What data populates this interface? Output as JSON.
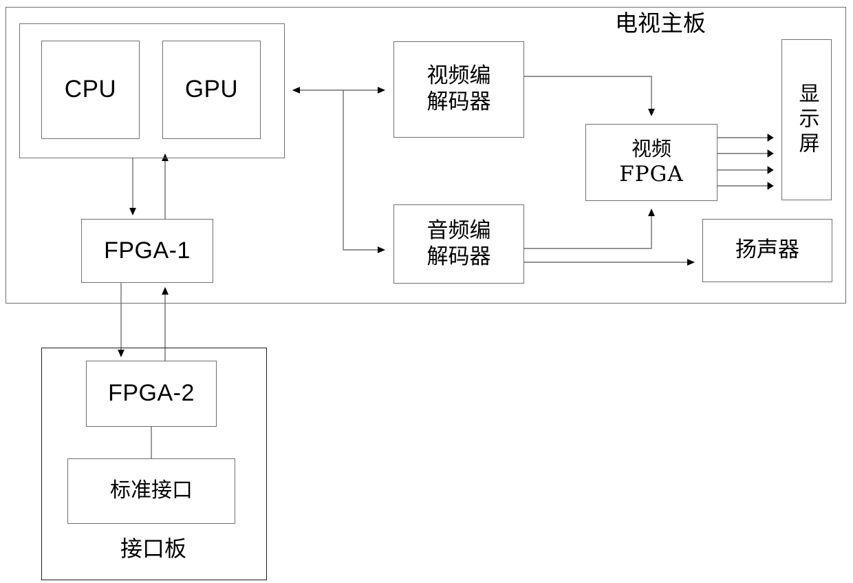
{
  "diagram": {
    "title": "电视主板",
    "title_en_hint": "TV motherboard block diagram",
    "background_color": "#ffffff",
    "line_color": "#6f6f6f",
    "text_color": "#000000"
  },
  "boards": {
    "motherboard": {
      "label": "电视主板"
    },
    "interface_board": {
      "label": "接口板"
    }
  },
  "blocks": {
    "soc": {
      "label": ""
    },
    "cpu": {
      "label": "CPU"
    },
    "gpu": {
      "label": "GPU"
    },
    "fpga1": {
      "label": "FPGA-1"
    },
    "fpga2": {
      "label": "FPGA-2"
    },
    "standard_interface": {
      "label": "标准接口"
    },
    "video_codec": {
      "line1": "视频编",
      "line2": "解码器"
    },
    "audio_codec": {
      "line1": "音频编",
      "line2": "解码器"
    },
    "video_fpga": {
      "line1": "视频",
      "line2": "FPGA"
    },
    "display": {
      "label": "显示屏"
    },
    "speaker": {
      "label": "扬声器"
    }
  },
  "connections": [
    {
      "from": "soc",
      "to": "video_codec",
      "type": "bidirectional-bus"
    },
    {
      "from": "soc",
      "to": "audio_codec",
      "type": "directed"
    },
    {
      "from": "soc",
      "to": "fpga1",
      "type": "down"
    },
    {
      "from": "fpga1",
      "to": "soc",
      "type": "up"
    },
    {
      "from": "fpga1",
      "to": "fpga2",
      "type": "down"
    },
    {
      "from": "fpga2",
      "to": "fpga1",
      "type": "up"
    },
    {
      "from": "fpga2",
      "to": "standard_interface",
      "type": "plain"
    },
    {
      "from": "video_codec",
      "to": "video_fpga",
      "type": "directed"
    },
    {
      "from": "audio_codec",
      "to": "video_fpga",
      "type": "directed"
    },
    {
      "from": "audio_codec",
      "to": "speaker",
      "type": "directed"
    },
    {
      "from": "video_fpga",
      "to": "display",
      "type": "directed",
      "count": 4
    }
  ]
}
